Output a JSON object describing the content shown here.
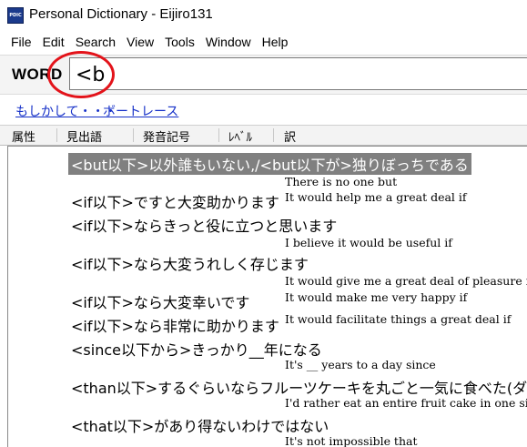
{
  "window": {
    "title": "Personal Dictionary - Eijiro131",
    "icon": "app-dictionary-icon",
    "icon_text": "PDIC"
  },
  "menu": [
    "File",
    "Edit",
    "Search",
    "View",
    "Tools",
    "Window",
    "Help"
  ],
  "search": {
    "label": "WORD",
    "value": "<b"
  },
  "suggestions": [
    "もしかして・・・",
    "ボートレース"
  ],
  "columns": [
    "属性",
    "見出語",
    "発音記号",
    "ﾚﾍﾞﾙ",
    "訳"
  ],
  "entries": [
    {
      "headword": "<but以下>以外誰もいない,/<but以下が>独りぼっちである",
      "translation": "There is no one but",
      "selected": true
    },
    {
      "headword": "<if以下>ですと大変助かります",
      "translation": "It would help me a great deal if",
      "selected": false
    },
    {
      "headword": "<if以下>ならきっと役に立つと思います",
      "translation": "I believe it would be useful if",
      "selected": false
    },
    {
      "headword": "<if以下>なら大変うれしく存じます",
      "translation": "It would give me a great deal of pleasure if",
      "selected": false
    },
    {
      "headword": "<if以下>なら大変幸いです",
      "translation": "It would make me very happy if",
      "selected": false
    },
    {
      "headword": "<if以下>なら非常に助かります",
      "translation": "It would facilitate things a great deal if",
      "selected": false
    },
    {
      "headword": "<since以下から>きっかり__年になる",
      "translation": "It's __ years to a day since",
      "selected": false
    },
    {
      "headword": "<than以下>するぐらいならフルーツケーキを丸ごと一気に食べた(ダイエット中の人が)",
      "translation": "I'd rather eat an entire fruit cake in one sitting than",
      "selected": false
    },
    {
      "headword": "<that以下>があり得ないわけではない",
      "translation": "It's not impossible that",
      "selected": false
    }
  ],
  "colors": {
    "selection": "#808080",
    "link": "#1530c8",
    "annotation": "#e3131a"
  }
}
